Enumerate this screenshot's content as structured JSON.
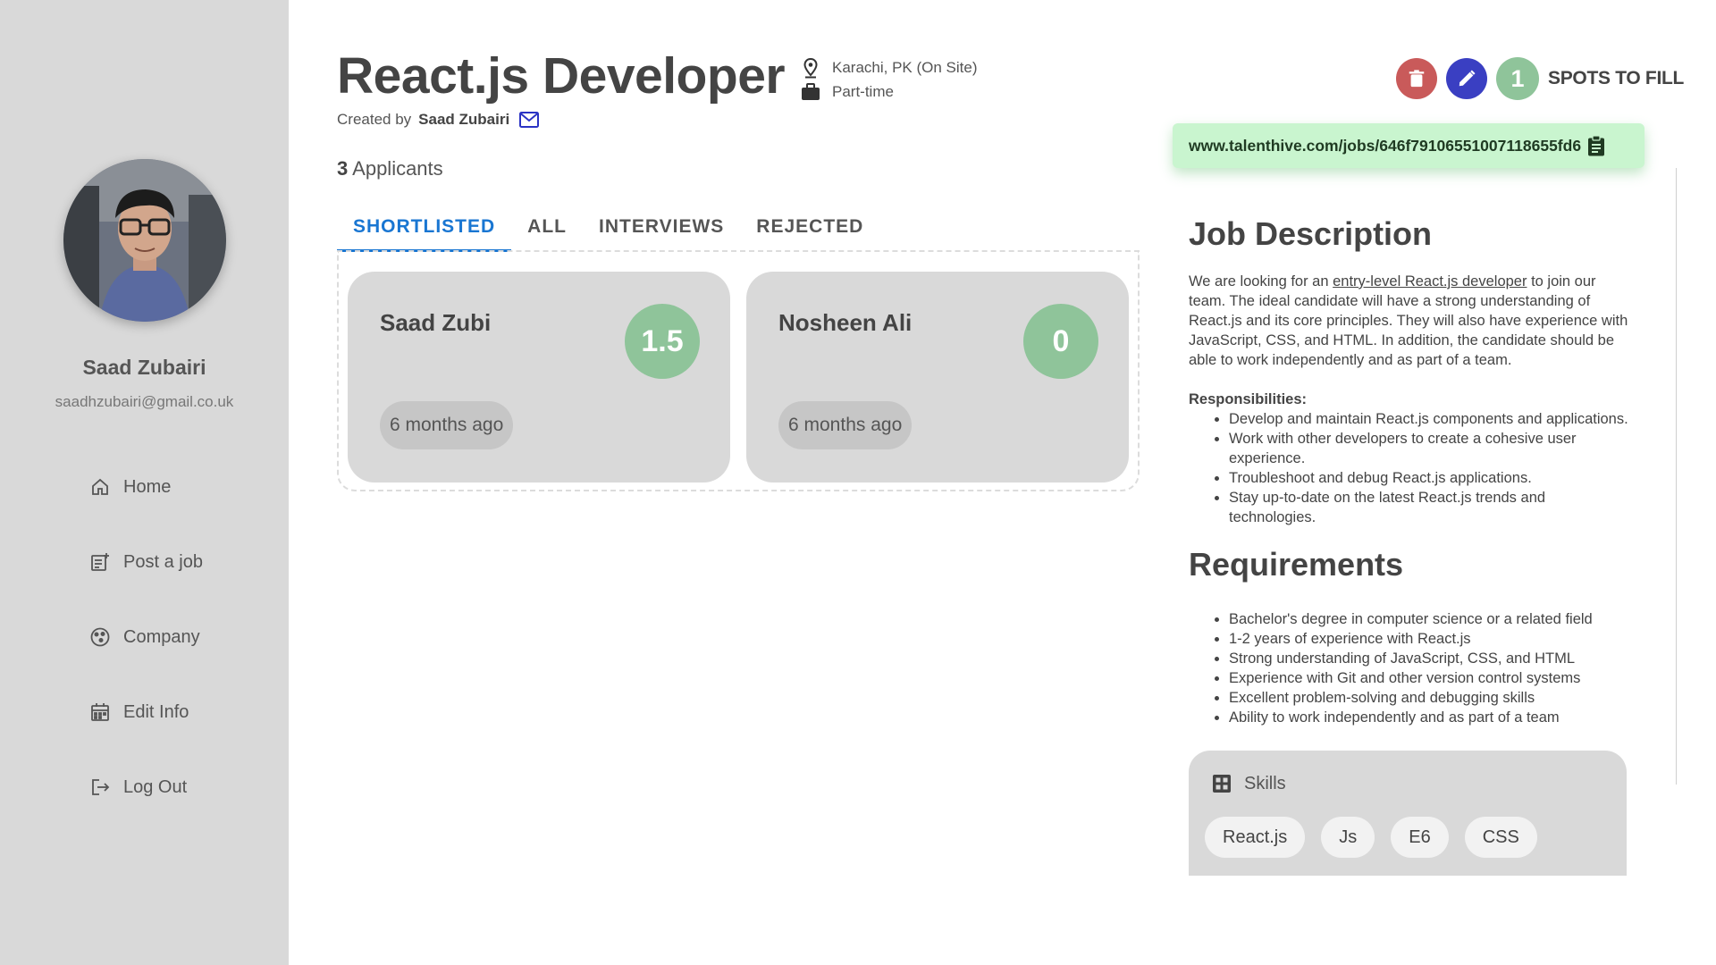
{
  "sidebar": {
    "user_name": "Saad Zubairi",
    "user_email": "saadhzubairi@gmail.co.uk",
    "nav": [
      {
        "label": "Home",
        "icon": "home-icon"
      },
      {
        "label": "Post a job",
        "icon": "post-job-icon"
      },
      {
        "label": "Company",
        "icon": "company-icon"
      },
      {
        "label": "Edit Info",
        "icon": "calendar-icon"
      },
      {
        "label": "Log Out",
        "icon": "logout-icon"
      }
    ]
  },
  "job": {
    "title": "React.js Developer",
    "created_by_label": "Created by",
    "creator": "Saad Zubairi",
    "location": "Karachi, PK (On Site)",
    "type": "Part-time",
    "applicant_count": "3",
    "applicants_label": "Applicants"
  },
  "tabs": [
    "SHORTLISTED",
    "ALL",
    "INTERVIEWS",
    "REJECTED"
  ],
  "active_tab": "SHORTLISTED",
  "candidates": [
    {
      "name": "Saad Zubi",
      "score": "1.5",
      "time": "6 months ago"
    },
    {
      "name": "Nosheen Ali",
      "score": "0",
      "time": "6 months ago"
    }
  ],
  "actions": {
    "spots": "1",
    "spots_label": "SPOTS TO FILL",
    "url": "www.talenthive.com/jobs/646f79106551007118655fd6"
  },
  "description": {
    "heading": "Job Description",
    "intro_before": "We are looking for an ",
    "intro_link": "entry-level React.js developer",
    "intro_after": " to join our team. The ideal candidate will have a strong understanding of React.js and its core principles. They will also have experience with JavaScript, CSS, and HTML. In addition, the candidate should be able to work independently and as part of a team.",
    "responsibilities_label": "Responsibilities:",
    "responsibilities": [
      "Develop and maintain React.js components and applications.",
      "Work with other developers to create a cohesive user experience.",
      "Troubleshoot and debug React.js applications.",
      "Stay up-to-date on the latest React.js trends and technologies."
    ],
    "requirements_heading": "Requirements",
    "requirements": [
      "Bachelor's degree in computer science or a related field",
      "1-2 years of experience with React.js",
      "Strong understanding of JavaScript, CSS, and HTML",
      "Experience with Git and other version control systems",
      "Excellent problem-solving and debugging skills",
      "Ability to work independently and as part of a team"
    ]
  },
  "skills": {
    "label": "Skills",
    "items": [
      "React.js",
      "Js",
      "E6",
      "CSS"
    ]
  },
  "colors": {
    "accent_blue": "#1976d2",
    "score_green": "#8fc49a",
    "delete_red": "#c95a5a",
    "edit_blue": "#3a3fc2",
    "url_bg": "#c9f5cf"
  }
}
